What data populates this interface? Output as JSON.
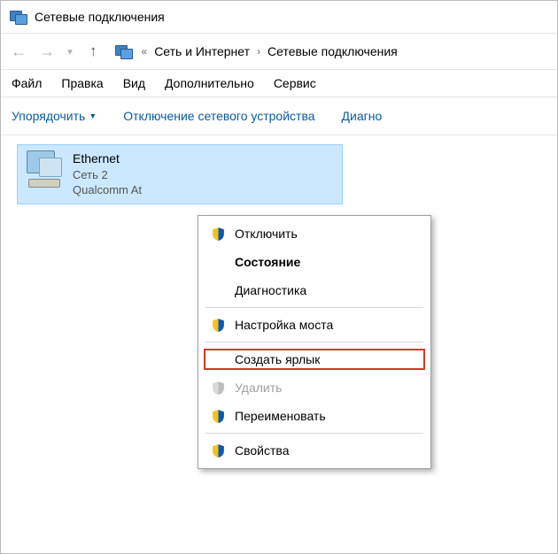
{
  "window": {
    "title": "Сетевые подключения"
  },
  "nav": {
    "back_state": "disabled",
    "fwd_state": "disabled",
    "path": {
      "root": "Сеть и Интернет",
      "current": "Сетевые подключения"
    }
  },
  "menu": {
    "file": "Файл",
    "edit": "Правка",
    "view": "Вид",
    "extra": "Дополнительно",
    "service": "Сервис"
  },
  "toolbar": {
    "organize": "Упорядочить",
    "disable_device": "Отключение сетевого устройства",
    "diagnose": "Диагно"
  },
  "adapter": {
    "name": "Ethernet",
    "network": "Сеть 2",
    "device": "Qualcomm At"
  },
  "ctx": {
    "disable": "Отключить",
    "status": "Состояние",
    "diag": "Диагностика",
    "bridge": "Настройка моста",
    "shortcut": "Создать ярлык",
    "delete": "Удалить",
    "rename": "Переименовать",
    "props": "Свойства"
  }
}
